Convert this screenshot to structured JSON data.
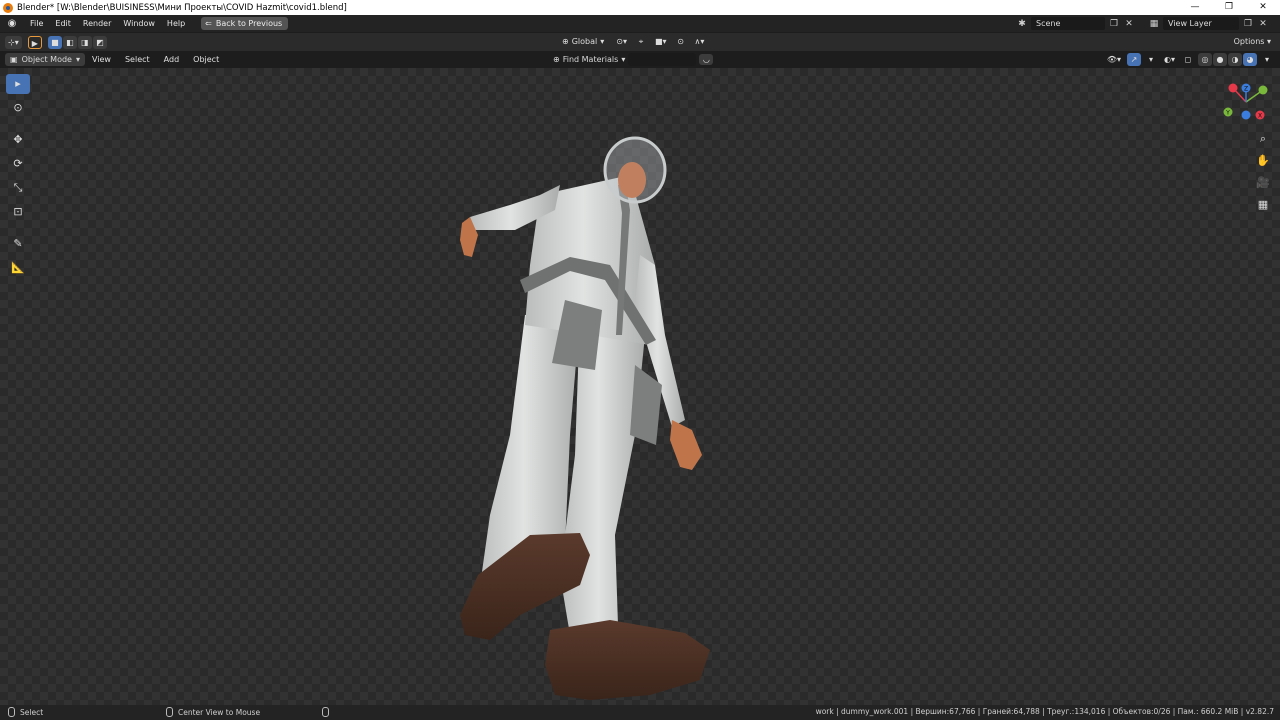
{
  "window": {
    "title": "Blender* [W:\\Blender\\BUISINESS\\Мини Проекты\\COVID Hazmit\\covid1.blend]",
    "controls": [
      "—",
      "❐",
      "✕"
    ]
  },
  "menubar": {
    "items": [
      "File",
      "Edit",
      "Render",
      "Window",
      "Help"
    ],
    "back_button": "Back to Previous",
    "scene": "Scene",
    "view_layer": "View Layer"
  },
  "toolheader": {
    "transform_orientation": "Global",
    "options_label": "Options"
  },
  "viewheader": {
    "mode": "Object Mode",
    "menus": [
      "View",
      "Select",
      "Add",
      "Object"
    ],
    "find_label": "Find Materials",
    "search_placeholder": ""
  },
  "gizmo": {
    "axes": [
      "X",
      "Y",
      "Z"
    ],
    "colors": {
      "x": "#e5394a",
      "y": "#7ab83c",
      "z": "#3b7ddd"
    }
  },
  "statusbar": {
    "left_hint": "Select",
    "middle_hint": "Center View to Mouse",
    "stats": "work | dummy_work.001 | Вершин:67,766 | Граней:64,788 | Треуг.:134,016 | Объектов:0/26 | Пам.: 660.2 MiB | v2.82.7"
  },
  "colors": {
    "accent": "#4772b3",
    "header": "#2b2b2b",
    "background": "#232323"
  }
}
